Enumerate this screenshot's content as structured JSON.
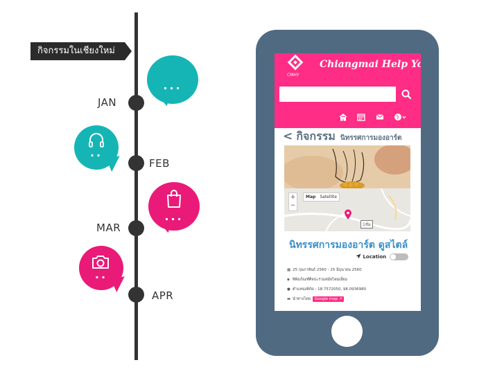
{
  "timeline": {
    "banner_title": "กิจกรรมในเชียงใหม่",
    "months": [
      "JAN",
      "FEB",
      "MAR",
      "APR"
    ],
    "bubbles": [
      {
        "icon": "chat-icon",
        "color": "#16b5b5",
        "text": "..."
      },
      {
        "icon": "headphones-icon",
        "color": "#16b5b5",
        "text": ".."
      },
      {
        "icon": "shopping-bag-icon",
        "color": "#ea1a78",
        "text": "..."
      },
      {
        "icon": "camera-icon",
        "color": "#ea1a78",
        "text": ".."
      }
    ]
  },
  "app": {
    "logo_text": "CMHY",
    "title": "Chiangmai Help You",
    "search": {
      "value": "",
      "placeholder": ""
    },
    "nav_icons": [
      "home-icon",
      "calendar-icon",
      "mail-icon",
      "globe-icon"
    ],
    "heading": {
      "back": "<",
      "title": "กิจกรรม",
      "subtitle": "นิทรรศการมองอาร์ต"
    },
    "map": {
      "zoom_in": "+",
      "zoom_out": "−",
      "types": [
        "Map",
        "Satellite"
      ],
      "road_label": "1ชั่ม"
    },
    "event": {
      "title": "นิทรรศการมองอาร์ต ดูสไตล์",
      "location_label": "Location",
      "date": "25 กุมภาพันธ์ 2560 - 25 มิถุนายน 2560",
      "venue": "พิพิธภัณฑ์ศิลปะร่วมสมัยไหม่เอี่ยม",
      "coordinates": "ตำแหน่งพิกัด : 18.7572050, 98.0936980",
      "directions_label": "นำทางโดย",
      "directions_button": "Google map"
    }
  },
  "colors": {
    "pink": "#ff2d86",
    "teal": "#16b5b5",
    "magenta": "#ea1a78",
    "phone": "#506a82",
    "timeline": "#333333"
  }
}
